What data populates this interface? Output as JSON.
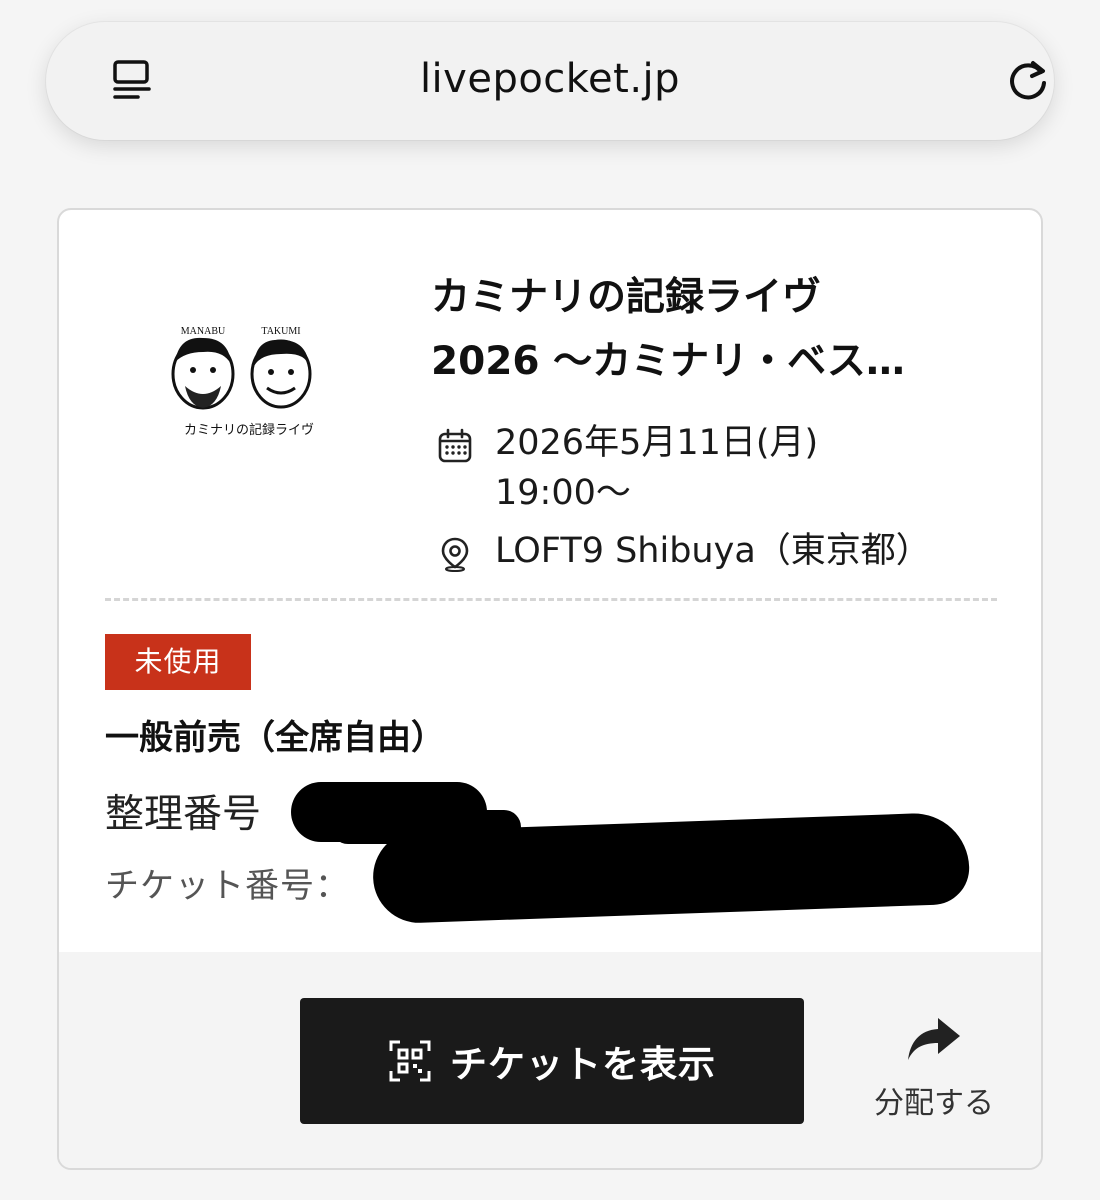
{
  "browser": {
    "url": "livepocket.jp",
    "reader_icon": "reader-mode-icon",
    "reload_icon": "reload-icon"
  },
  "event": {
    "title_line1": "カミナリの記録ライヴ",
    "title_line2": "2026 〜カミナリ・ベス…",
    "datetime_line1": "2026年5月11日(月)",
    "datetime_line2": "19:00〜",
    "venue": "LOFT9 Shibuya（東京都）",
    "thumbnail": {
      "left_name": "MANABU",
      "right_name": "TAKUMI",
      "caption": "カミナリの記録ライヴ"
    }
  },
  "ticket": {
    "status": "未使用",
    "status_color": "#c8321a",
    "type": "一般前売（全席自由）",
    "seq_label": "整理番号",
    "number_label": "チケット番号："
  },
  "actions": {
    "show_ticket": "チケットを表示",
    "share": "分配する"
  }
}
